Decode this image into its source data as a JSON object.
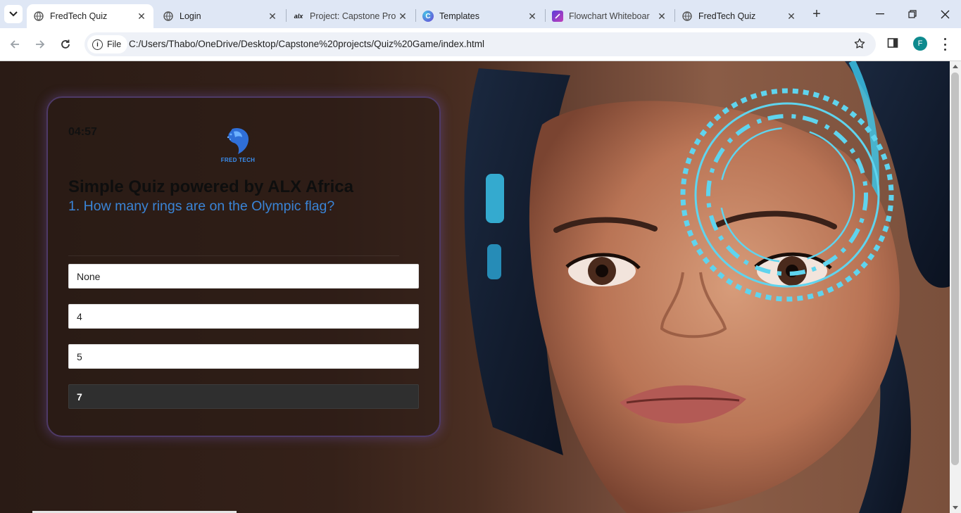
{
  "tabs": [
    {
      "title": "FredTech Quiz",
      "icon": "globe-icon",
      "active": true
    },
    {
      "title": "Login",
      "icon": "globe-icon",
      "active": false
    },
    {
      "title": "Project: Capstone Pro",
      "icon": "alx-icon",
      "icon_text": "alx",
      "active": false
    },
    {
      "title": "Templates",
      "icon": "canva-icon",
      "icon_text": "C",
      "active": false
    },
    {
      "title": "Flowchart Whiteboar",
      "icon": "whiteboard-icon",
      "active": false
    },
    {
      "title": "FredTech Quiz",
      "icon": "globe-icon",
      "active": false
    }
  ],
  "omnibox": {
    "scheme_label": "File",
    "url": "C:/Users/Thabo/OneDrive/Desktop/Capstone%20projects/Quiz%20Game/index.html"
  },
  "profile": {
    "initial": "F",
    "color": "#0e8a8e"
  },
  "quiz": {
    "timer": "04:57",
    "logo_text": "FRED TECH",
    "title": "Simple Quiz powered by ALX Africa",
    "question": "1. How many rings are on the Olympic flag?",
    "options": [
      "None",
      "4",
      "5",
      "7"
    ],
    "selected_index": 3
  },
  "colors": {
    "accent_question": "#3a84d6",
    "card_border": "#4e3a67",
    "hero_ring": "#5fd4ee"
  }
}
